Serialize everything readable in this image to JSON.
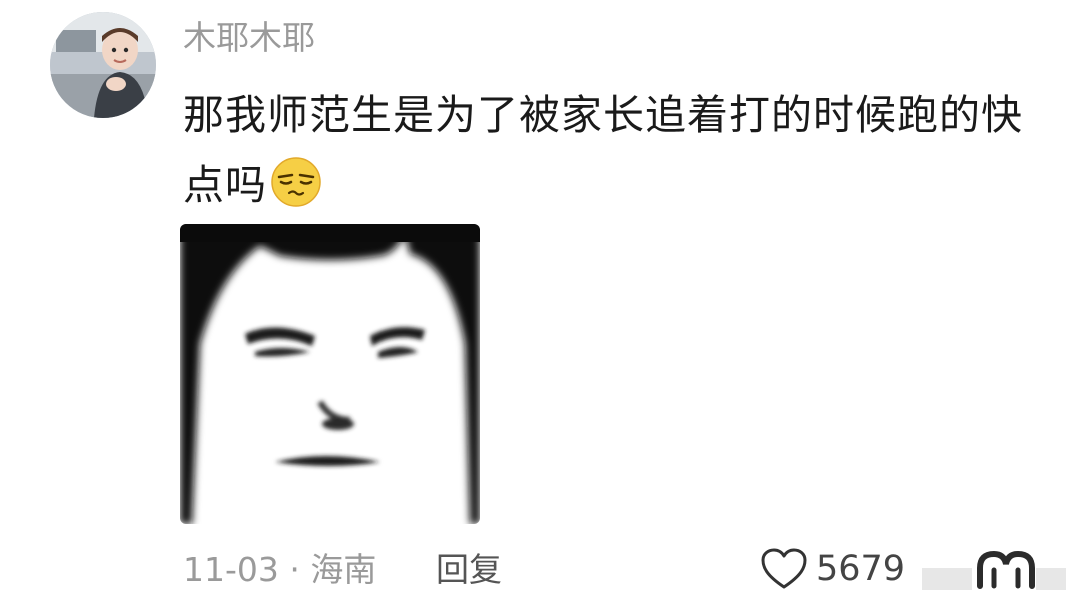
{
  "comment": {
    "username": "木耶木耶",
    "text": "那我师范生是为了被家长追着打的时候跑的快点吗",
    "inline_emoji": "smirk-emoji-icon",
    "sticker": "grumpy-face-sticker",
    "date": "11-03",
    "location_separator": "·",
    "location": "海南",
    "reply_label": "回复",
    "like_count": "5679",
    "like_icon": "heart-outline-icon",
    "watermark_icon": "platform-logo-icon"
  },
  "colors": {
    "meta_gray": "#9a9a9a",
    "text": "#1a1a1a",
    "emoji_yellow": "#f6cf45"
  }
}
